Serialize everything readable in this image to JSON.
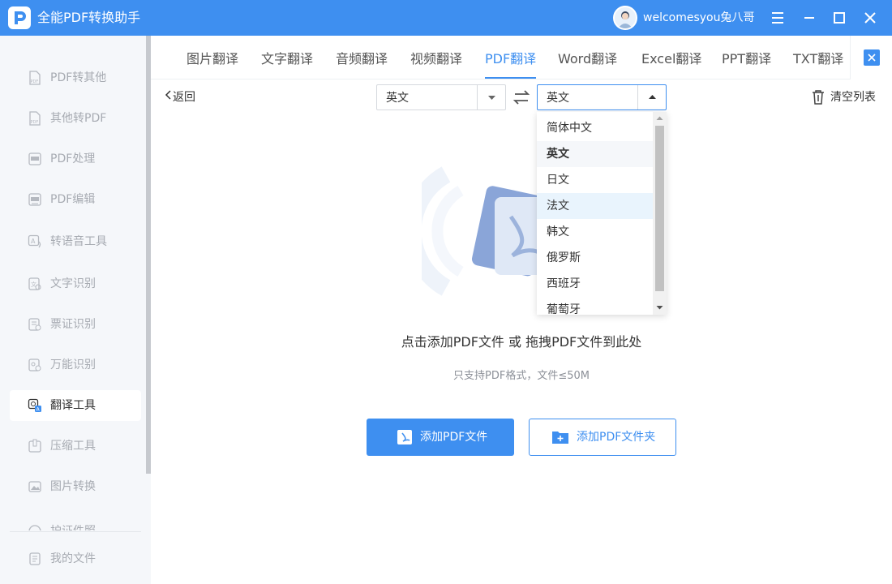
{
  "app": {
    "title": "全能PDF转换助手",
    "logo_icon": "pdf-p-logo-icon",
    "username": "welcomesyou兔八哥",
    "brand_color": "#3e8ff0"
  },
  "window_controls": [
    "menu-icon",
    "minimize-icon",
    "maximize-icon",
    "close-icon"
  ],
  "sidebar": {
    "items": [
      {
        "label": "PDF转其他",
        "icon": "pdf-file-icon"
      },
      {
        "label": "其他转PDF",
        "icon": "pdf-file-icon"
      },
      {
        "label": "PDF处理",
        "icon": "pdf-process-icon"
      },
      {
        "label": "PDF编辑",
        "icon": "pdf-edit-icon"
      },
      {
        "label": "转语音工具",
        "icon": "text-to-speech-icon"
      },
      {
        "label": "文字识别",
        "icon": "ocr-icon"
      },
      {
        "label": "票证识别",
        "icon": "ticket-scan-icon"
      },
      {
        "label": "万能识别",
        "icon": "universal-scan-icon"
      },
      {
        "label": "翻译工具",
        "icon": "translate-icon",
        "active": true
      },
      {
        "label": "压缩工具",
        "icon": "compress-icon"
      },
      {
        "label": "图片转换",
        "icon": "image-convert-icon"
      },
      {
        "label": "护证件照",
        "icon": "id-photo-icon"
      }
    ],
    "bottom_item": {
      "label": "我的文件",
      "icon": "my-files-icon"
    }
  },
  "tabs": [
    {
      "label": "图片翻译"
    },
    {
      "label": "文字翻译"
    },
    {
      "label": "音频翻译"
    },
    {
      "label": "视频翻译"
    },
    {
      "label": "PDF翻译",
      "active": true
    },
    {
      "label": "Word翻译"
    },
    {
      "label": "Excel翻译"
    },
    {
      "label": "PPT翻译"
    },
    {
      "label": "TXT翻译"
    }
  ],
  "toolbar": {
    "back_label": "返回",
    "source_language": "英文",
    "target_language": "英文",
    "clear_list_label": "清空列表"
  },
  "dropdown": {
    "options": [
      "简体中文",
      "英文",
      "日文",
      "法文",
      "韩文",
      "俄罗斯",
      "西班牙",
      "葡萄牙"
    ],
    "selected": "英文",
    "hovered": "法文"
  },
  "main": {
    "drop_text": "点击添加PDF文件 或 拖拽PDF文件到此处",
    "hint_text": "只支持PDF格式，文件≤50M",
    "add_file_label": "添加PDF文件",
    "add_folder_label": "添加PDF文件夹"
  }
}
